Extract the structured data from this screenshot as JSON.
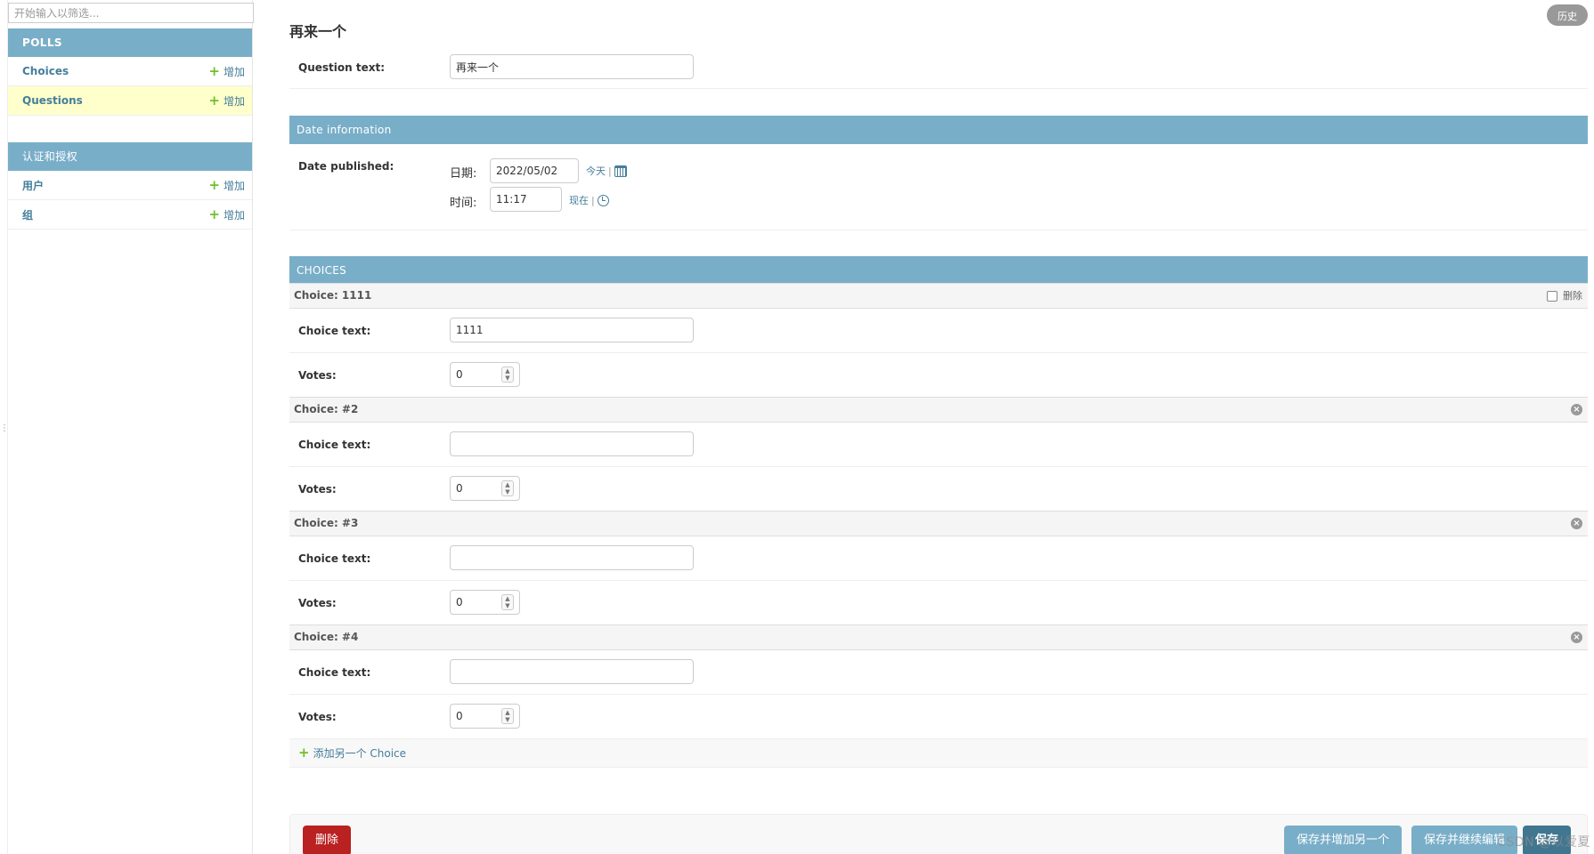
{
  "sidebar": {
    "filter_placeholder": "开始输入以筛选...",
    "modules": [
      {
        "caption": "POLLS",
        "rows": [
          {
            "label": "Choices",
            "add": "增加",
            "active": false
          },
          {
            "label": "Questions",
            "add": "增加",
            "active": true
          }
        ]
      },
      {
        "caption": "认证和授权",
        "rows": [
          {
            "label": "用户",
            "add": "增加",
            "active": false
          },
          {
            "label": "组",
            "add": "增加",
            "active": false
          }
        ]
      }
    ]
  },
  "header": {
    "title": "再来一个",
    "history_button": "历史"
  },
  "question": {
    "label": "Question text:",
    "value": "再来一个"
  },
  "date_section": {
    "caption": "Date information",
    "label": "Date published:",
    "date_label": "日期:",
    "date_value": "2022/05/02",
    "today_link": "今天",
    "time_label": "时间:",
    "time_value": "11:17",
    "now_link": "现在",
    "separator": "|"
  },
  "choices_section": {
    "caption": "CHOICES",
    "delete_label": "删除",
    "choice_text_label": "Choice text:",
    "votes_label": "Votes:",
    "items": [
      {
        "title": "Choice: 1111",
        "text": "1111",
        "votes": "0"
      },
      {
        "title": "Choice: #2",
        "text": "",
        "votes": "0"
      },
      {
        "title": "Choice: #3",
        "text": "",
        "votes": "0"
      },
      {
        "title": "Choice: #4",
        "text": "",
        "votes": "0"
      }
    ],
    "add_another": "添加另一个 Choice"
  },
  "submit": {
    "delete": "删除",
    "save_add_another": "保存并增加另一个",
    "save_continue": "保存并继续编辑",
    "save": "保存"
  },
  "watermark": "CSDN @以爱夏"
}
